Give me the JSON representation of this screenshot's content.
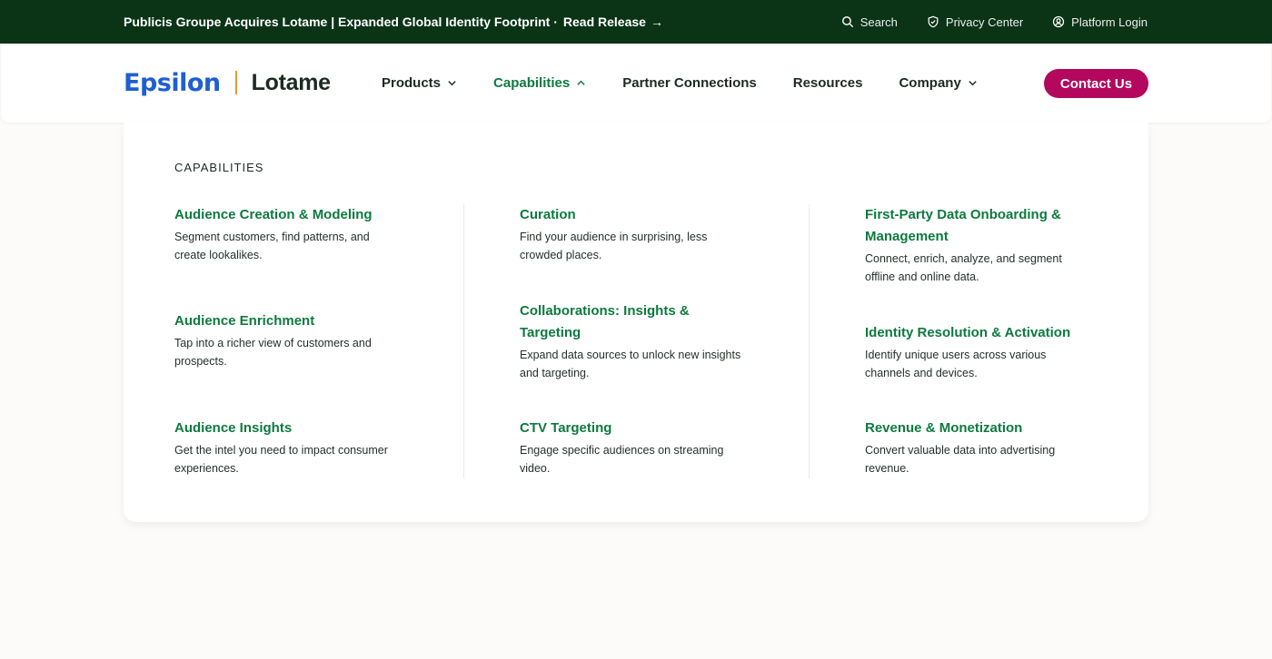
{
  "topbar": {
    "announcement": "Publicis Groupe Acquires Lotame | Expanded Global Identity Footprint ·",
    "release_link": "Read Release",
    "arrow": "→",
    "utility": [
      {
        "label": "Search",
        "icon": "search-icon"
      },
      {
        "label": "Privacy Center",
        "icon": "shield-icon"
      },
      {
        "label": "Platform Login",
        "icon": "user-icon"
      }
    ]
  },
  "logo": {
    "epsilon": "Epsilon",
    "lotame": "Lotame"
  },
  "nav": {
    "items": [
      {
        "label": "Products",
        "has_chevron": true,
        "active": false
      },
      {
        "label": "Capabilities",
        "has_chevron": true,
        "active": true
      },
      {
        "label": "Partner Connections",
        "has_chevron": false,
        "active": false
      },
      {
        "label": "Resources",
        "has_chevron": false,
        "active": false
      },
      {
        "label": "Company",
        "has_chevron": true,
        "active": false
      }
    ],
    "contact_label": "Contact Us"
  },
  "dropdown": {
    "heading": "CAPABILITIES",
    "columns": [
      [
        {
          "title": "Audience Creation & Modeling",
          "desc": "Segment customers, find patterns, and create lookalikes."
        },
        {
          "title": "Audience Enrichment",
          "desc": "Tap into a richer view of customers and prospects."
        },
        {
          "title": "Audience Insights",
          "desc": "Get the intel you need to impact consumer experiences."
        }
      ],
      [
        {
          "title": "Curation",
          "desc": "Find your audience in surprising, less crowded places."
        },
        {
          "title": "Collaborations: Insights & Targeting",
          "desc": "Expand data sources to unlock new insights and targeting."
        },
        {
          "title": "CTV Targeting",
          "desc": "Engage specific audiences on streaming video."
        }
      ],
      [
        {
          "title": "First-Party Data Onboarding & Management",
          "desc": "Connect, enrich, analyze, and segment offline and online data."
        },
        {
          "title": "Identity Resolution & Activation",
          "desc": "Identify unique users across various channels and devices."
        },
        {
          "title": "Revenue & Monetization",
          "desc": "Convert valuable data into advertising revenue."
        }
      ]
    ]
  },
  "colors": {
    "topbar_bg": "#0b3417",
    "accent_green": "#0c7a3e",
    "contact_magenta": "#b3085e",
    "epsilon_blue": "#1f5fd1",
    "logo_divider": "#e59a3c"
  }
}
